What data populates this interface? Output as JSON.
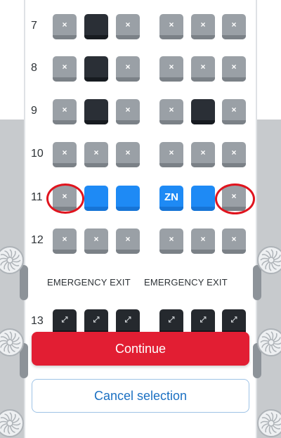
{
  "rows": [
    {
      "number": "7",
      "seats": [
        "avail",
        "occ",
        "avail",
        "avail",
        "avail",
        "avail"
      ],
      "labels": [
        "",
        "",
        "",
        "",
        "",
        ""
      ]
    },
    {
      "number": "8",
      "seats": [
        "avail",
        "occ",
        "avail",
        "avail",
        "avail",
        "avail"
      ],
      "labels": [
        "",
        "",
        "",
        "",
        "",
        ""
      ]
    },
    {
      "number": "9",
      "seats": [
        "avail",
        "occ",
        "avail",
        "avail",
        "occ",
        "avail"
      ],
      "labels": [
        "",
        "",
        "",
        "",
        "",
        ""
      ]
    },
    {
      "number": "10",
      "seats": [
        "avail",
        "avail",
        "avail",
        "avail",
        "avail",
        "avail"
      ],
      "labels": [
        "",
        "",
        "",
        "",
        "",
        ""
      ]
    },
    {
      "number": "11",
      "seats": [
        "avail",
        "sel",
        "sel",
        "sel",
        "sel",
        "avail"
      ],
      "labels": [
        "",
        "",
        "",
        "ZN",
        "",
        ""
      ]
    },
    {
      "number": "12",
      "seats": [
        "avail",
        "avail",
        "avail",
        "avail",
        "avail",
        "avail"
      ],
      "labels": [
        "",
        "",
        "",
        "",
        "",
        ""
      ]
    },
    {
      "number": "13",
      "seats": [
        "exit",
        "exit",
        "exit",
        "exit",
        "exit",
        "exit"
      ],
      "labels": [
        "",
        "",
        "",
        "",
        "",
        ""
      ]
    }
  ],
  "emergency_exit": {
    "left": "EMERGENCY EXIT",
    "right": "EMERGENCY EXIT"
  },
  "buttons": {
    "continue": "Continue",
    "cancel": "Cancel selection"
  },
  "colors": {
    "available": "#9aa0a6",
    "occupied": "#2a2f36",
    "selected": "#1e8af5",
    "exit_row": "#25292e",
    "continue_button": "#e21e33",
    "annotation_circle": "#e0141e"
  },
  "annotations": [
    "circle-row-11-seat-A",
    "circle-row-11-seat-F"
  ]
}
